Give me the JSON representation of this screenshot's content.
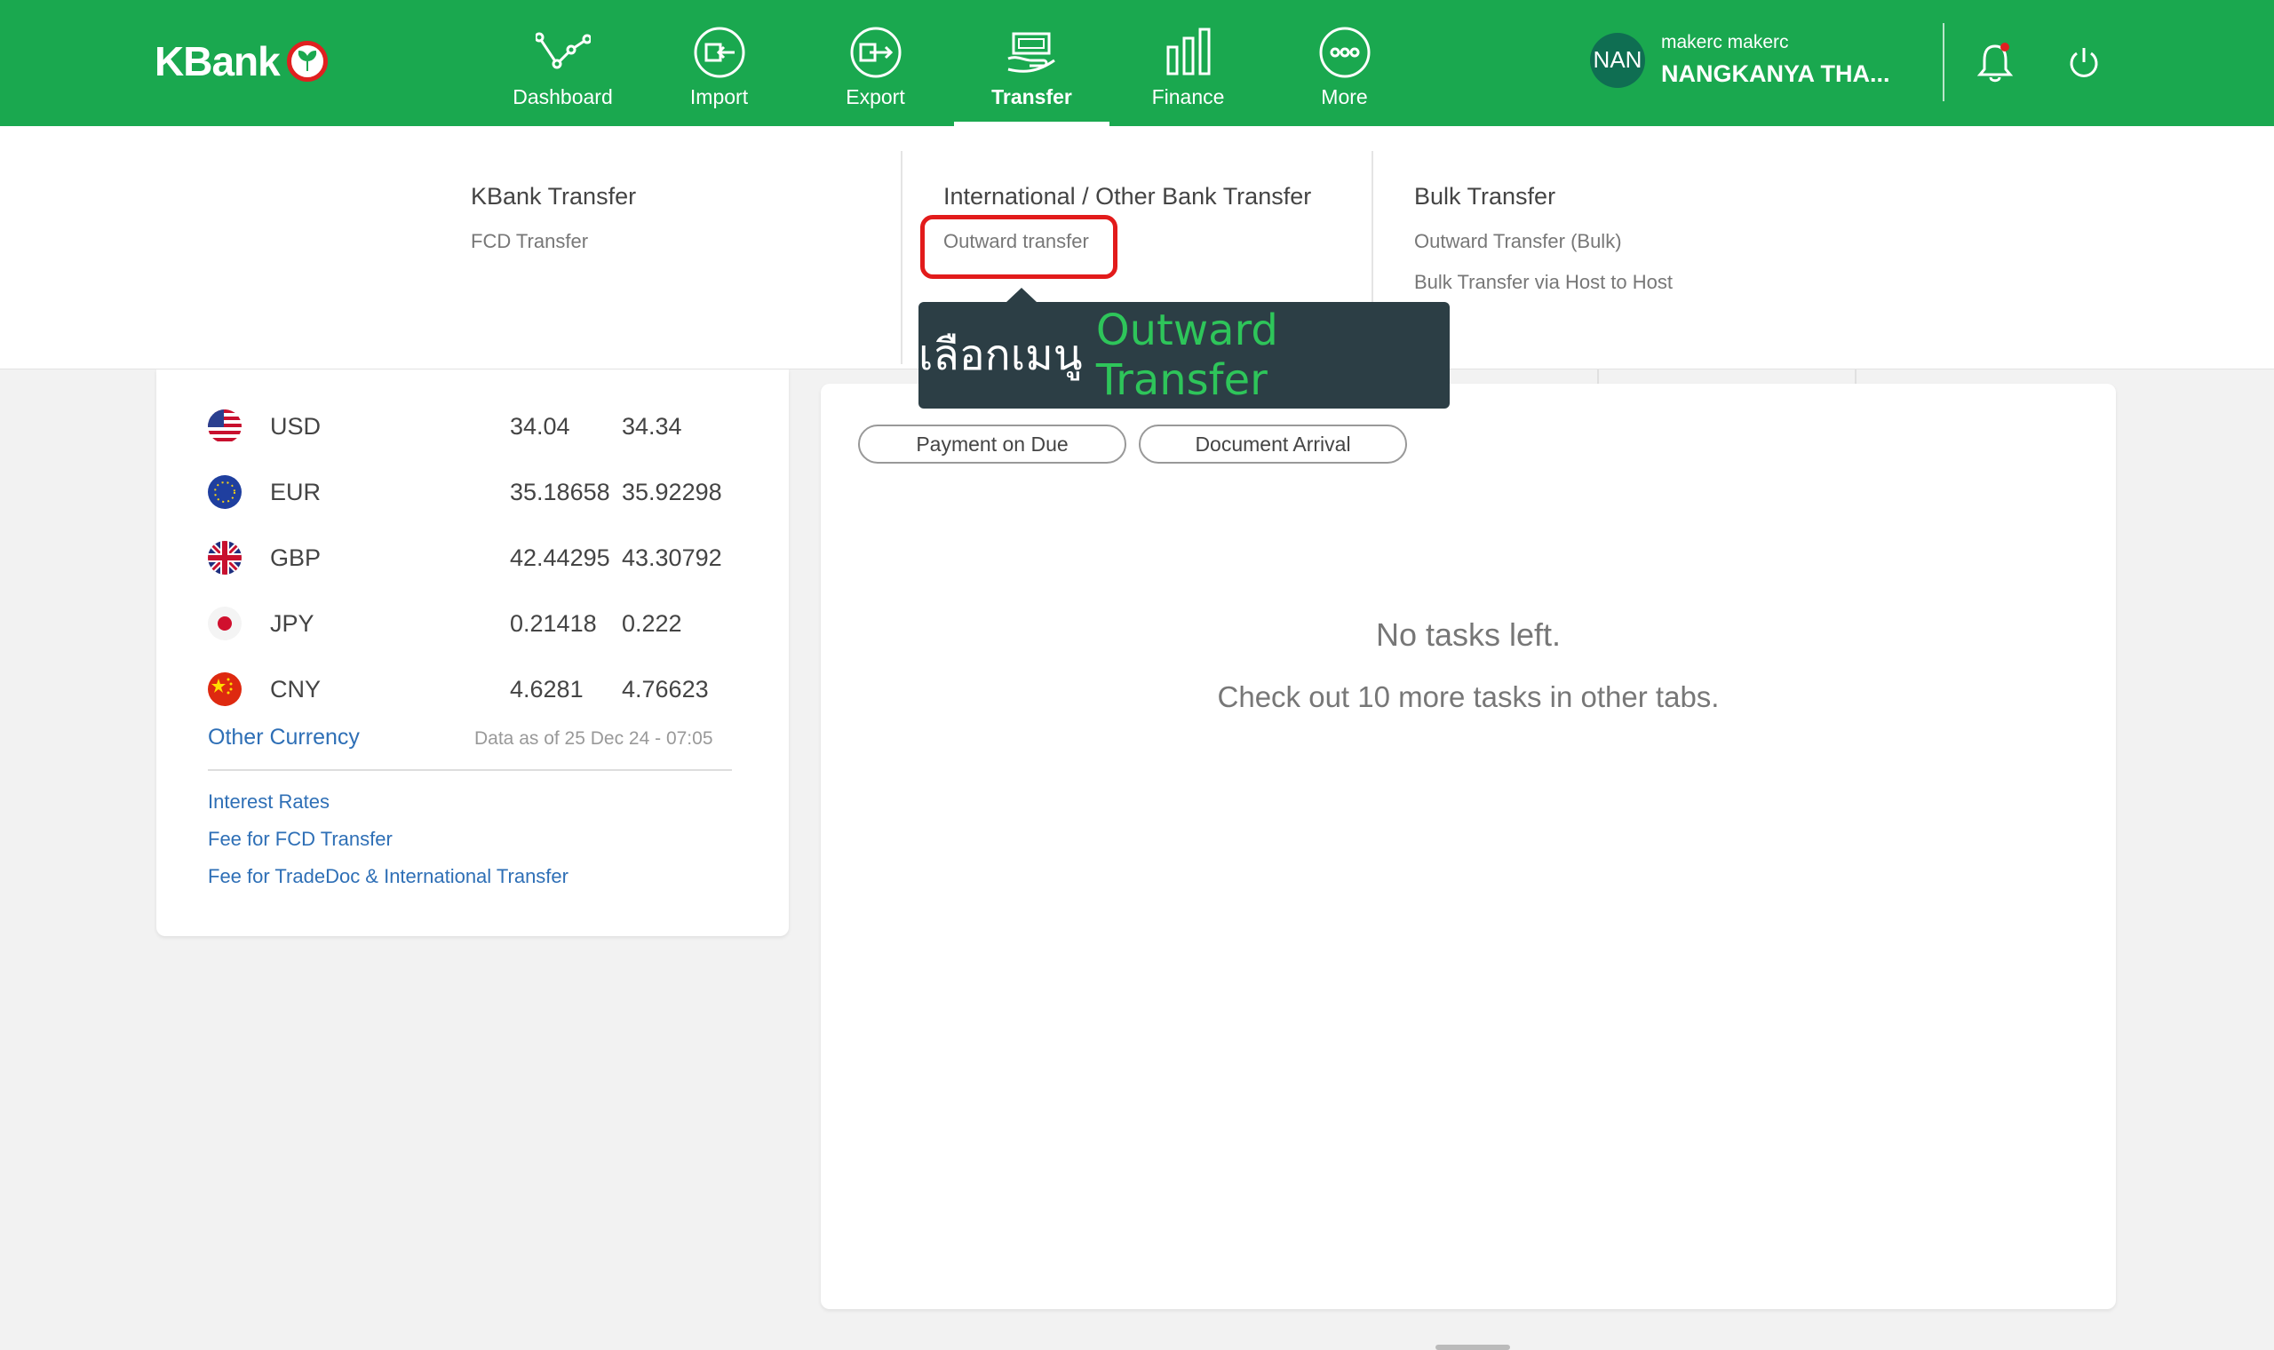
{
  "brand": {
    "name": "KBank"
  },
  "nav": [
    {
      "label": "Dashboard",
      "icon": "dashboard-icon"
    },
    {
      "label": "Import",
      "icon": "import-icon"
    },
    {
      "label": "Export",
      "icon": "export-icon"
    },
    {
      "label": "Transfer",
      "icon": "transfer-icon",
      "active": true
    },
    {
      "label": "Finance",
      "icon": "finance-icon"
    },
    {
      "label": "More",
      "icon": "more-icon"
    }
  ],
  "user": {
    "initials": "NAN",
    "username": "makerc makerc",
    "company": "NANGKANYA THA..."
  },
  "dropdown": {
    "kbank": {
      "title": "KBank Transfer",
      "links": [
        "FCD Transfer"
      ]
    },
    "intl": {
      "title": "International / Other Bank Transfer",
      "links": [
        "Outward transfer"
      ]
    },
    "bulk": {
      "title": "Bulk Transfer",
      "links": [
        "Outward Transfer (Bulk)",
        "Bulk Transfer via Host to Host"
      ]
    }
  },
  "tooltip": {
    "prefix": "เลือกเมนู ",
    "highlight": "Outward Transfer"
  },
  "rates": [
    {
      "code": "USD",
      "buy": "34.04",
      "sell": "34.34",
      "flag": "us-flag-icon"
    },
    {
      "code": "EUR",
      "buy": "35.18658",
      "sell": "35.92298",
      "flag": "eu-flag-icon"
    },
    {
      "code": "GBP",
      "buy": "42.44295",
      "sell": "43.30792",
      "flag": "uk-flag-icon"
    },
    {
      "code": "JPY",
      "buy": "0.21418",
      "sell": "0.222",
      "flag": "jp-flag-icon"
    },
    {
      "code": "CNY",
      "buy": "4.6281",
      "sell": "4.76623",
      "flag": "cn-flag-icon"
    }
  ],
  "other_currency": "Other Currency",
  "data_as_of": "Data as of 25 Dec 24 - 07:05",
  "side_links": [
    "Interest Rates",
    "Fee for FCD Transfer",
    "Fee for TradeDoc & International Transfer"
  ],
  "tasks": {
    "filters": [
      "Payment on Due",
      "Document Arrival"
    ],
    "empty_title": "No tasks left.",
    "empty_subtitle": "Check out 10 more tasks in other tabs."
  },
  "colors": {
    "primary": "#1aa84f",
    "highlight_border": "#e21b1b",
    "tooltip_bg": "#2c3e45",
    "tooltip_accent": "#2ec55a",
    "link": "#2e6fb6"
  }
}
